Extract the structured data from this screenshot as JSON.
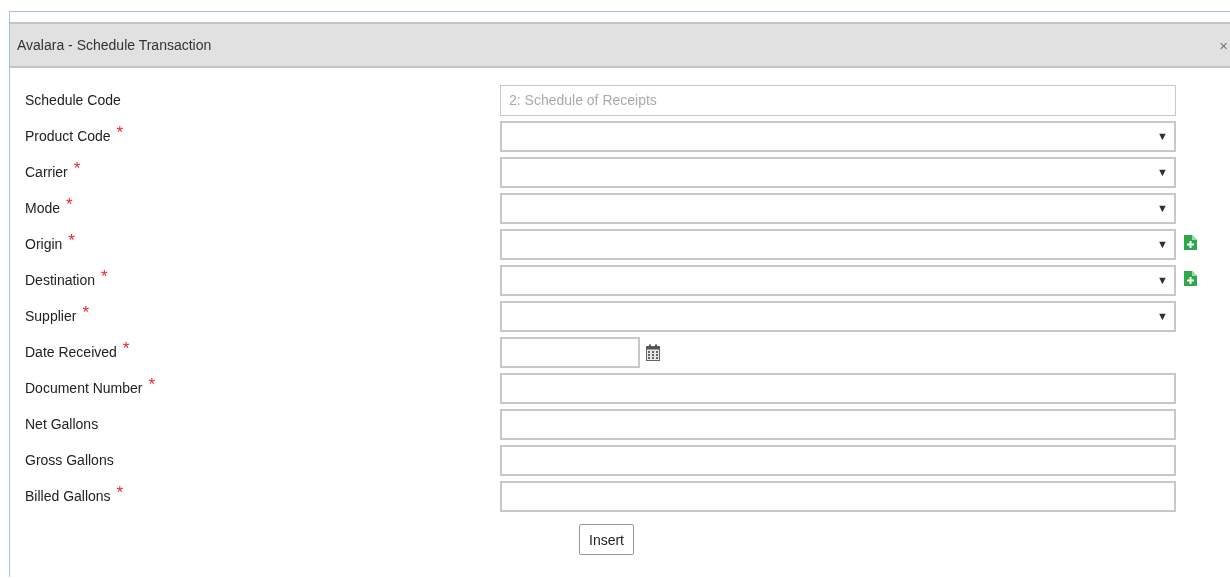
{
  "dialog": {
    "title": "Avalara - Schedule Transaction",
    "close": "×"
  },
  "fields": [
    {
      "label": "Schedule Code",
      "kind": "text",
      "required": false,
      "disabled": true,
      "value": "2: Schedule of Receipts",
      "add_button": false
    },
    {
      "label": "Product Code",
      "kind": "select",
      "required": true,
      "disabled": false,
      "add_button": false
    },
    {
      "label": "Carrier",
      "kind": "select",
      "required": true,
      "disabled": false,
      "add_button": false
    },
    {
      "label": "Mode",
      "kind": "select",
      "required": true,
      "disabled": false,
      "add_button": false
    },
    {
      "label": "Origin",
      "kind": "select",
      "required": true,
      "disabled": false,
      "add_button": true
    },
    {
      "label": "Destination",
      "kind": "select",
      "required": true,
      "disabled": false,
      "add_button": true
    },
    {
      "label": "Supplier",
      "kind": "select",
      "required": true,
      "disabled": false,
      "add_button": false
    },
    {
      "label": "Date Received",
      "kind": "date",
      "required": true,
      "disabled": false,
      "add_button": false
    },
    {
      "label": "Document Number",
      "kind": "text",
      "required": true,
      "disabled": false,
      "add_button": false
    },
    {
      "label": "Net Gallons",
      "kind": "text",
      "required": false,
      "disabled": false,
      "add_button": false
    },
    {
      "label": "Gross Gallons",
      "kind": "text",
      "required": false,
      "disabled": false,
      "add_button": false
    },
    {
      "label": "Billed Gallons",
      "kind": "text",
      "required": true,
      "disabled": false,
      "add_button": false
    }
  ],
  "required_mark": "*",
  "select_caret": "▼",
  "buttons": [
    "Insert"
  ]
}
